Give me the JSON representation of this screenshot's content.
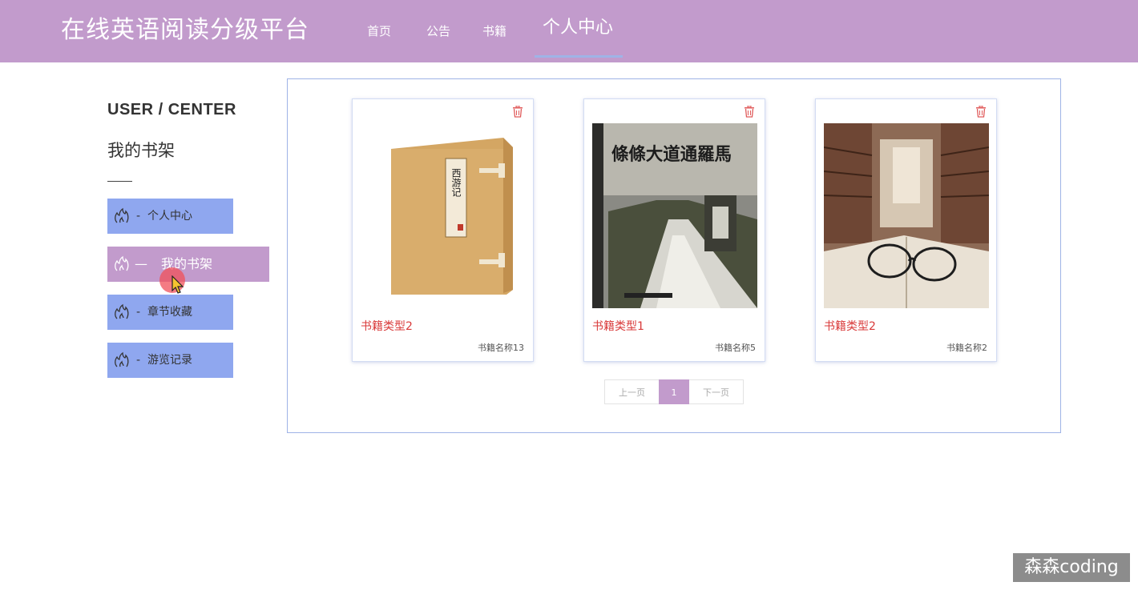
{
  "header": {
    "brand": "在线英语阅读分级平台",
    "nav": [
      {
        "label": "首页"
      },
      {
        "label": "公告"
      },
      {
        "label": "书籍"
      },
      {
        "label": "个人中心",
        "active": true
      }
    ]
  },
  "sidebar": {
    "title": "USER / CENTER",
    "subtitle": "我的书架",
    "items": [
      {
        "label": "个人中心",
        "sep": "-",
        "icon": "flame-icon"
      },
      {
        "label": "我的书架",
        "sep": "—",
        "icon": "flame-icon",
        "active": true
      },
      {
        "label": "章节收藏",
        "sep": "-",
        "icon": "flame-icon"
      },
      {
        "label": "游览记录",
        "sep": "-",
        "icon": "flame-icon"
      }
    ]
  },
  "books": [
    {
      "type": "书籍类型2",
      "name": "书籍名称13",
      "cover": "boxed-book-cover",
      "cover_title": "西游记"
    },
    {
      "type": "书籍类型1",
      "name": "书籍名称5",
      "cover": "road-book-cover",
      "cover_title": "條條大道通羅馬"
    },
    {
      "type": "书籍类型2",
      "name": "书籍名称2",
      "cover": "library-glasses-cover"
    }
  ],
  "pagination": {
    "prev": "上一页",
    "current": "1",
    "next": "下一页"
  },
  "watermark": "森森coding",
  "colors": {
    "header": "#c29bcc",
    "menu": "#8fa7ef",
    "active": "#c29bcc",
    "type_text": "#d93a3a",
    "panel_border": "#9fb3e6"
  }
}
